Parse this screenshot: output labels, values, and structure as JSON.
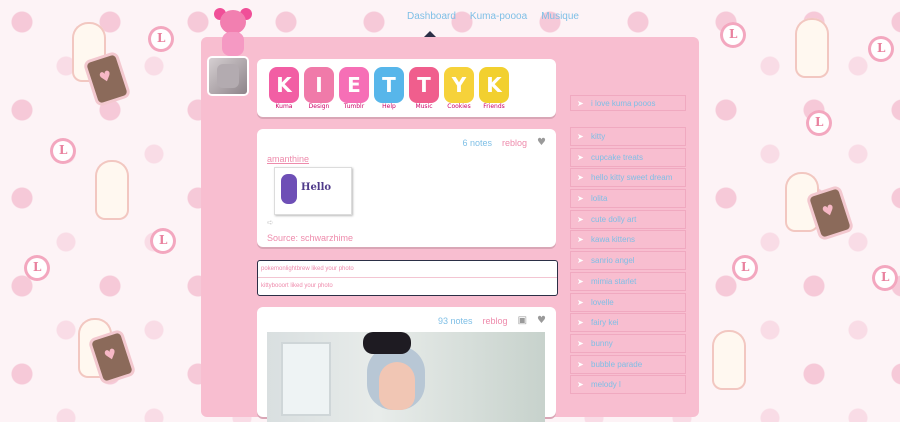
{
  "nav": {
    "items": [
      "Dashboard",
      "Kuma-poooa",
      "Musique"
    ]
  },
  "header_letters": [
    {
      "char": "K",
      "tag": "Kuma",
      "color": "#f25ea4"
    },
    {
      "char": "I",
      "tag": "Design",
      "color": "#f07aa9"
    },
    {
      "char": "E",
      "tag": "Tumblr",
      "color": "#f66fb6"
    },
    {
      "char": "T",
      "tag": "Help",
      "color": "#57b6ea"
    },
    {
      "char": "T",
      "tag": "Music",
      "color": "#f05e8d"
    },
    {
      "char": "Y",
      "tag": "Cookies",
      "color": "#f6d23a"
    },
    {
      "char": "K",
      "tag": "Friends",
      "color": "#f2d02f"
    }
  ],
  "post2": {
    "notes": "6 notes",
    "reblog": "reblog",
    "user": "amanthine",
    "image_text": "Hello",
    "source": "Source: schwarzhime"
  },
  "asks": [
    "pokemonlightbrew liked your photo",
    "kittybooort liked your photo"
  ],
  "post3": {
    "notes": "93 notes",
    "reblog": "reblog"
  },
  "sidebar": {
    "title": "i love kuma pooos",
    "items": [
      "kitty",
      "cupcake treats",
      "hello kitty sweet dream",
      "lolita",
      "cute dolly art",
      "kawa kittens",
      "sanrio angel",
      "mimia starlet",
      "lovelle",
      "fairy kei",
      "bunny",
      "bubble parade",
      "melody l"
    ]
  },
  "colors": {
    "column_pink": "#f8bed0",
    "link_blue": "#7ebfe6",
    "link_pink": "#ee8bac"
  }
}
